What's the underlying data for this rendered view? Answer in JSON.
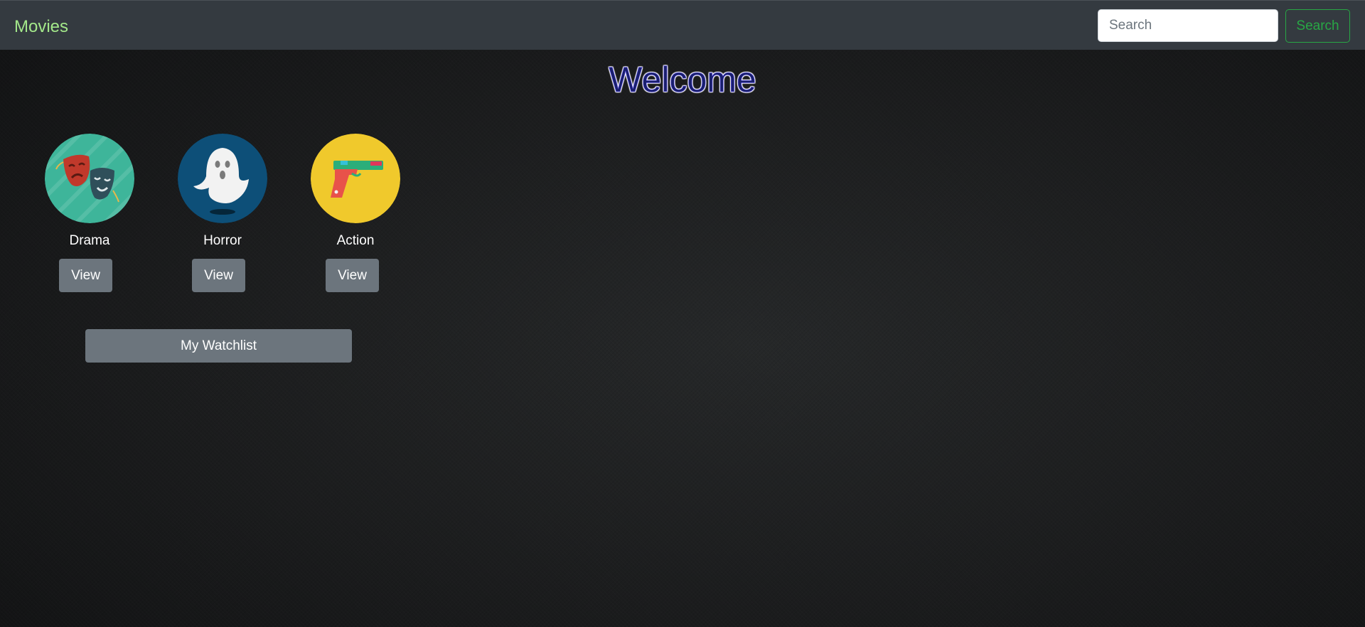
{
  "navbar": {
    "brand": "Movies",
    "search_placeholder": "Search",
    "search_button": "Search"
  },
  "heading": "Welcome",
  "genres": [
    {
      "label": "Drama",
      "button": "View",
      "icon": "theater-masks-icon",
      "color": "#3eb59a"
    },
    {
      "label": "Horror",
      "button": "View",
      "icon": "ghost-icon",
      "color": "#0d4f78"
    },
    {
      "label": "Action",
      "button": "View",
      "icon": "pistol-icon",
      "color": "#f0c92c"
    }
  ],
  "watchlist_button": "My Watchlist",
  "colors": {
    "navbar_bg": "#343a40",
    "brand": "#a3e88a",
    "search_accent": "#28a745",
    "secondary_button": "#6c757d"
  }
}
